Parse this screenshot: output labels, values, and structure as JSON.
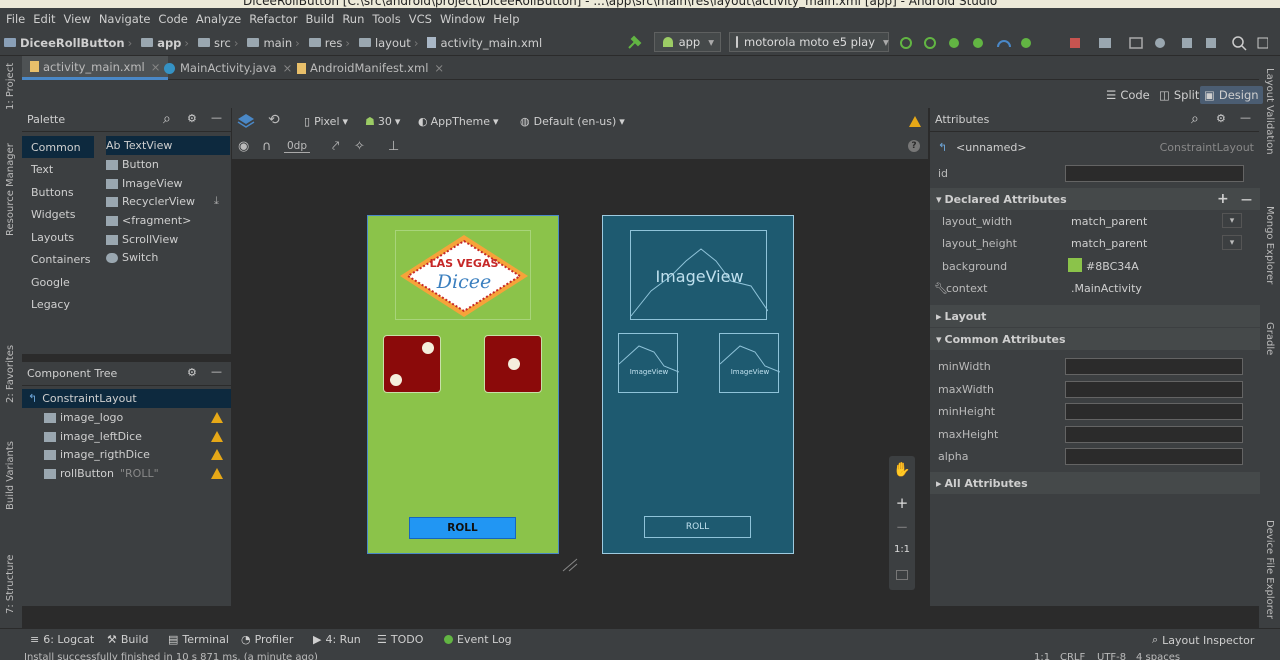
{
  "window": {
    "title": "DiceeRollButton [C:\\src\\android\\project\\DiceeRollButton] - ...\\app\\src\\main\\res\\layout\\activity_main.xml [app] - Android Studio"
  },
  "menu": [
    "File",
    "Edit",
    "View",
    "Navigate",
    "Code",
    "Analyze",
    "Refactor",
    "Build",
    "Run",
    "Tools",
    "VCS",
    "Window",
    "Help"
  ],
  "breadcrumb": [
    "DiceeRollButton",
    "app",
    "src",
    "main",
    "res",
    "layout",
    "activity_main.xml"
  ],
  "toolbar": {
    "run_config": "app",
    "device": "motorola moto e5 play"
  },
  "editor_tabs": [
    {
      "label": "activity_main.xml"
    },
    {
      "label": "MainActivity.java"
    },
    {
      "label": "AndroidManifest.xml"
    }
  ],
  "left_strip": {
    "project": "1: Project",
    "resource_manager": "Resource Manager",
    "favorites": "2: Favorites",
    "build_variants": "Build Variants",
    "structure": "7: Structure"
  },
  "right_strip": {
    "layout_validation": "Layout Validation",
    "mongo": "Mongo Explorer",
    "gradle": "Gradle",
    "device_file": "Device File Explorer"
  },
  "view_modes": {
    "code": "Code",
    "split": "Split",
    "design": "Design"
  },
  "palette": {
    "title": "Palette",
    "categories": [
      "Common",
      "Text",
      "Buttons",
      "Widgets",
      "Layouts",
      "Containers",
      "Google",
      "Legacy"
    ],
    "items": [
      "Ab TextView",
      "Button",
      "ImageView",
      "RecyclerView",
      "<fragment>",
      "ScrollView",
      "Switch"
    ]
  },
  "component_tree": {
    "title": "Component Tree",
    "root": "ConstraintLayout",
    "children": [
      {
        "label": "image_logo",
        "suffix": ""
      },
      {
        "label": "image_leftDice",
        "suffix": ""
      },
      {
        "label": "image_rigthDice",
        "suffix": ""
      },
      {
        "label": "rollButton",
        "suffix": "\"ROLL\""
      }
    ]
  },
  "design_toolbar": {
    "device": "Pixel",
    "api": "30",
    "theme": "AppTheme",
    "locale": "Default (en-us)",
    "margin": "0dp"
  },
  "preview": {
    "logo_line1": "LAS VEGAS",
    "logo_line2": "Dicee",
    "roll_label": "ROLL",
    "bg_color": "#8BC34A",
    "button_color": "#2196F3"
  },
  "blueprint": {
    "image_label": "ImageView",
    "small_label": "ImageView",
    "roll_label": "ROLL"
  },
  "zoom": {
    "plus": "+",
    "minus": "−",
    "ratio": "1:1"
  },
  "attributes": {
    "title": "Attributes",
    "component": "<unnamed>",
    "component_type": "ConstraintLayout",
    "id_label": "id",
    "declared_title": "Declared Attributes",
    "declared": [
      {
        "name": "layout_width",
        "value": "match_parent"
      },
      {
        "name": "layout_height",
        "value": "match_parent"
      },
      {
        "name": "background",
        "value": "#8BC34A"
      },
      {
        "name": "context",
        "value": ".MainActivity"
      }
    ],
    "layout_section": "Layout",
    "common_title": "Common Attributes",
    "common": [
      "minWidth",
      "maxWidth",
      "minHeight",
      "maxHeight",
      "alpha"
    ],
    "all_title": "All Attributes"
  },
  "bottom_tools": [
    "6: Logcat",
    "Build",
    "Terminal",
    "Profiler",
    "4: Run",
    "TODO",
    "Event Log"
  ],
  "layout_inspector": "Layout Inspector",
  "status": {
    "message": "Install successfully finished in 10 s 871 ms. (a minute ago)",
    "position": "1:1",
    "line_sep": "CRLF",
    "encoding": "UTF-8",
    "indent": "4 spaces"
  }
}
